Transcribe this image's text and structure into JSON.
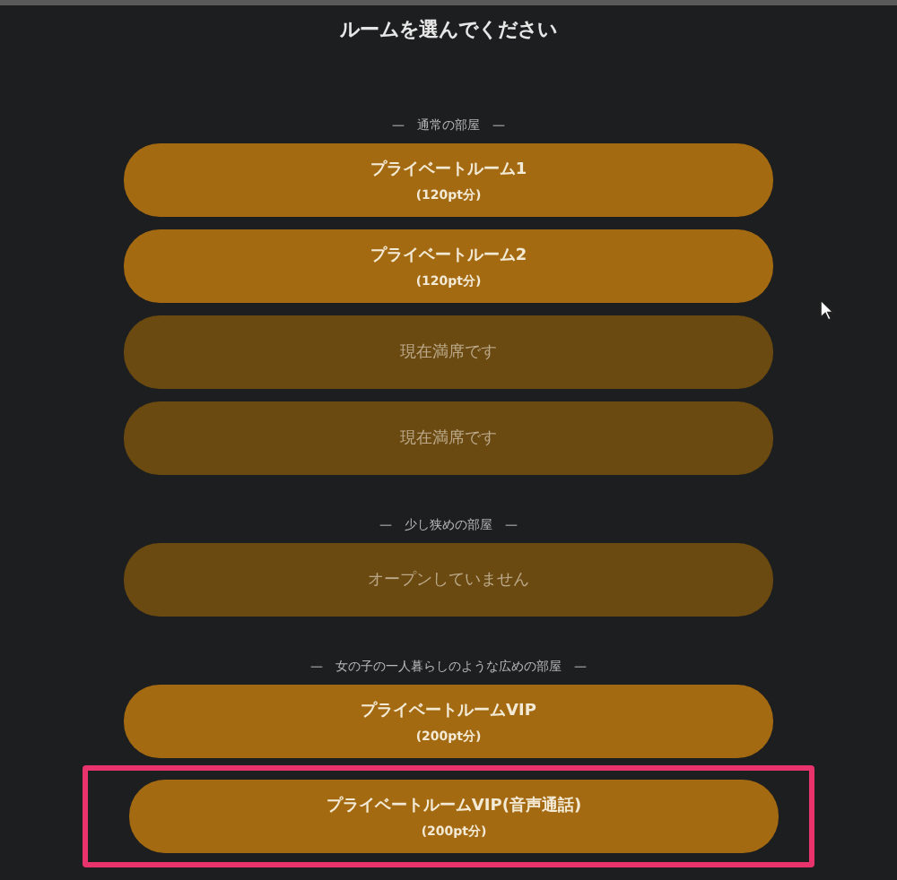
{
  "title": "ルームを選んでください",
  "sections": [
    {
      "heading": "—　通常の部屋　—",
      "rooms": [
        {
          "name": "プライベートルーム1",
          "price": "(120pt分)",
          "available": true,
          "highlighted": false
        },
        {
          "name": "プライベートルーム2",
          "price": "(120pt分)",
          "available": true,
          "highlighted": false
        },
        {
          "name": "現在満席です",
          "available": false,
          "highlighted": false
        },
        {
          "name": "現在満席です",
          "available": false,
          "highlighted": false
        }
      ]
    },
    {
      "heading": "—　少し狭めの部屋　—",
      "rooms": [
        {
          "name": "オープンしていません",
          "available": false,
          "highlighted": false
        }
      ]
    },
    {
      "heading": "—　女の子の一人暮らしのような広めの部屋　—",
      "rooms": [
        {
          "name": "プライベートルームVIP",
          "price": "(200pt分)",
          "available": true,
          "highlighted": false
        },
        {
          "name": "プライベートルームVIP(音声通話)",
          "price": "(200pt分)",
          "available": true,
          "highlighted": true
        }
      ]
    }
  ]
}
